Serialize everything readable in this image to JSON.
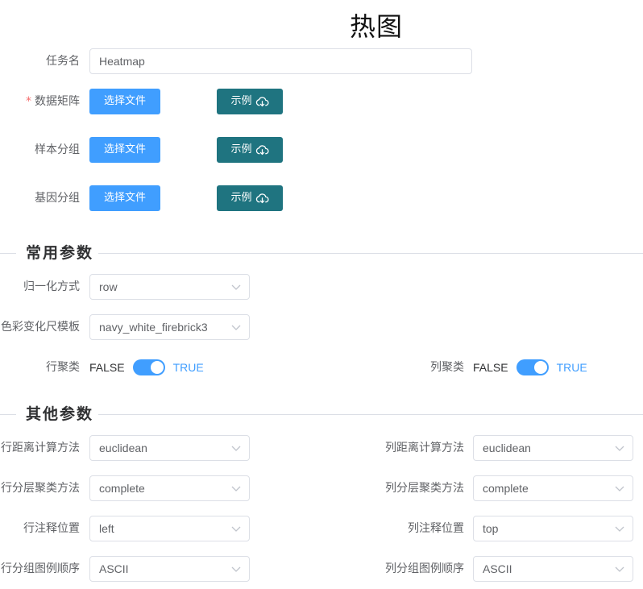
{
  "page_title": "热图",
  "task": {
    "label": "任务名",
    "value": "Heatmap"
  },
  "uploads": [
    {
      "label": "数据矩阵",
      "required": "*",
      "file_button": "选择文件",
      "example_button": "示例"
    },
    {
      "label": "样本分组",
      "file_button": "选择文件",
      "example_button": "示例"
    },
    {
      "label": "基因分组",
      "file_button": "选择文件",
      "example_button": "示例"
    }
  ],
  "sections": {
    "common": "常用参数",
    "other": "其他参数"
  },
  "common": {
    "normalize": {
      "label": "归一化方式",
      "value": "row"
    },
    "color_scale": {
      "label": "色彩变化尺模板",
      "value": "navy_white_firebrick3"
    },
    "row_cluster": {
      "label": "行聚类",
      "off": "FALSE",
      "on": "TRUE",
      "state": true
    },
    "col_cluster": {
      "label": "列聚类",
      "off": "FALSE",
      "on": "TRUE",
      "state": true
    }
  },
  "other": {
    "row_distance": {
      "label": "行距离计算方法",
      "value": "euclidean"
    },
    "col_distance": {
      "label": "列距离计算方法",
      "value": "euclidean"
    },
    "row_method": {
      "label": "行分层聚类方法",
      "value": "complete"
    },
    "col_method": {
      "label": "列分层聚类方法",
      "value": "complete"
    },
    "row_anno": {
      "label": "行注释位置",
      "value": "left"
    },
    "col_anno": {
      "label": "列注释位置",
      "value": "top"
    },
    "row_order": {
      "label": "行分组图例顺序",
      "value": "ASCII"
    },
    "col_order": {
      "label": "列分组图例顺序",
      "value": "ASCII"
    }
  },
  "colors": {
    "primary": "#409eff",
    "example": "#1f7480",
    "required": "#f56c6c"
  }
}
